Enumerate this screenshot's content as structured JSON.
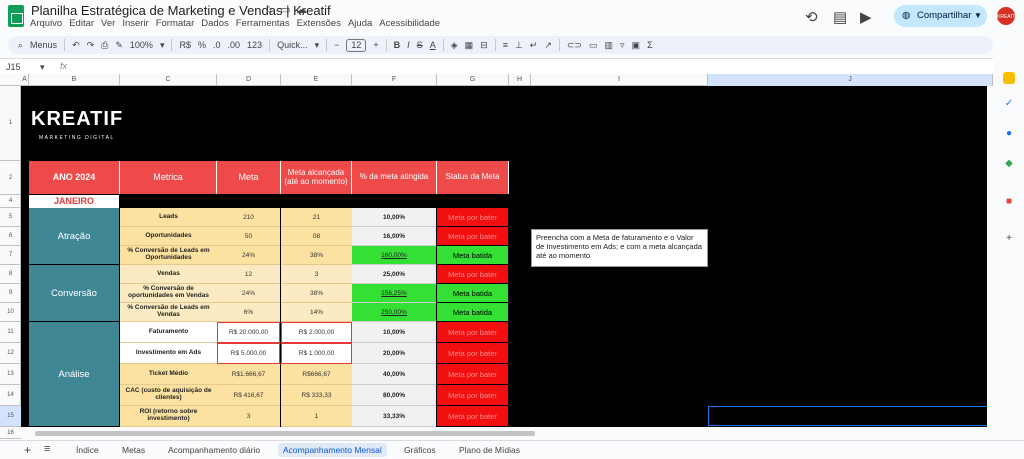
{
  "title": "Planilha Estratégica de Marketing e Vendas | Kreatif",
  "menu": [
    "Arquivo",
    "Editar",
    "Ver",
    "Inserir",
    "Formatar",
    "Dados",
    "Ferramentas",
    "Extensões",
    "Ajuda",
    "Acessibilidade"
  ],
  "share_label": "Compartilhar",
  "avatar_text": "KREATIF",
  "toolbar": {
    "search": "Menus",
    "zoom": "100%",
    "currency": "R$",
    "percent": "%",
    "dec_minus": ".0",
    "dec_plus": ".00",
    "number_format": "123",
    "font": "Quick...",
    "font_size": "12",
    "bold": "B",
    "italic": "I",
    "strike": "S",
    "text_color": "A",
    "sigma": "Σ"
  },
  "cell_ref": "J15",
  "fx": "fx",
  "columns": [
    "A",
    "B",
    "C",
    "D",
    "E",
    "F",
    "G",
    "H",
    "I",
    "J"
  ],
  "rows": [
    "1",
    "2",
    "4",
    "5",
    "6",
    "7",
    "8",
    "9",
    "10",
    "11",
    "12",
    "13",
    "14",
    "15",
    "16"
  ],
  "brand": {
    "name": "KREATIF",
    "subtitle": "MARKETING DIGITAL"
  },
  "headers": {
    "year": "ANO 2024",
    "metric": "Metrica",
    "goal": "Meta",
    "achieved": "Meta alcançada (até ao momento)",
    "pct": "% da meta atingida",
    "status": "Status da Meta"
  },
  "month": "JANEIRO",
  "categories": [
    "Atração",
    "Conversão",
    "Análise"
  ],
  "metrics": [
    {
      "name": "Leads",
      "goal": "210",
      "achieved": "21",
      "pct": "10,00%",
      "status": "Meta por bater",
      "ok": false
    },
    {
      "name": "Oportunidades",
      "goal": "50",
      "achieved": "08",
      "pct": "16,00%",
      "status": "Meta por bater",
      "ok": false
    },
    {
      "name": "% Conversão de Leads em Oportunidades",
      "goal": "24%",
      "achieved": "38%",
      "pct": "160,00%",
      "status": "Meta batida",
      "ok": true
    },
    {
      "name": "Vendas",
      "goal": "12",
      "achieved": "3",
      "pct": "25,00%",
      "status": "Meta por bater",
      "ok": false
    },
    {
      "name": "% Conversão de oportunidades em Vendas",
      "goal": "24%",
      "achieved": "38%",
      "pct": "156,25%",
      "status": "Meta batida",
      "ok": true
    },
    {
      "name": "% Conversão de Leads em Vendas",
      "goal": "6%",
      "achieved": "14%",
      "pct": "250,00%",
      "status": "Meta batida",
      "ok": true
    },
    {
      "name": "Faturamento",
      "goal": "R$ 20.000,00",
      "achieved": "R$ 2.000,00",
      "pct": "10,00%",
      "status": "Meta por bater",
      "ok": false
    },
    {
      "name": "Investimento em Ads",
      "goal": "R$ 5.000,00",
      "achieved": "R$ 1.000,00",
      "pct": "20,00%",
      "status": "Meta por bater",
      "ok": false
    },
    {
      "name": "Ticket Médio",
      "goal": "R$1.666,67",
      "achieved": "R$666,67",
      "pct": "40,00%",
      "status": "Meta por bater",
      "ok": false
    },
    {
      "name": "CAC (custo de aquisição de clientes)",
      "goal": "R$ 416,67",
      "achieved": "R$ 333,33",
      "pct": "80,00%",
      "status": "Meta por bater",
      "ok": false
    },
    {
      "name": "ROI (retorno sobre investimento)",
      "goal": "3",
      "achieved": "1",
      "pct": "33,33%",
      "status": "Meta por bater",
      "ok": false
    }
  ],
  "note": "Preencha com a Meta de faturamento e o Valor de Investimento em Ads; e com a meta alcançada até ao momento",
  "tabs": [
    "Índice",
    "Metas",
    "Acompanhamento diário",
    "Acompanhamento Mensal",
    "Gráficos",
    "Plano de Mídias"
  ],
  "active_tab": "Acompanhamento Mensal",
  "add_sheet": "+",
  "all_sheets": "≡",
  "colors": {
    "header_red": "#ef4a4a",
    "category_teal": "#3f8795",
    "metric_yellow": "#fde1a1",
    "status_red": "#f10f0f",
    "status_green": "#35e035",
    "share_blue": "#c2e7ff"
  }
}
